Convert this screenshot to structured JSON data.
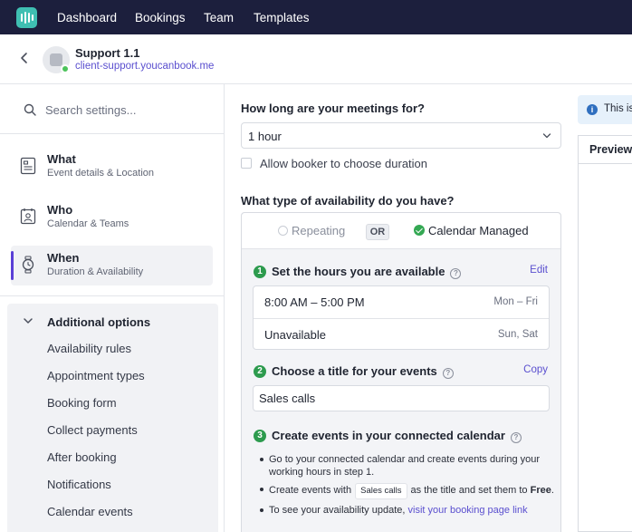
{
  "nav": {
    "items": [
      "Dashboard",
      "Bookings",
      "Team",
      "Templates"
    ]
  },
  "header": {
    "title": "Support 1.1",
    "link": "client-support.youcanbook.me"
  },
  "sidebar": {
    "search_placeholder": "Search settings...",
    "items": [
      {
        "label": "What",
        "sub": "Event details & Location",
        "icon": "document-icon"
      },
      {
        "label": "Who",
        "sub": "Calendar & Teams",
        "icon": "user-card-icon"
      },
      {
        "label": "When",
        "sub": "Duration & Availability",
        "icon": "watch-icon"
      }
    ],
    "additional_title": "Additional options",
    "additional_items": [
      "Availability rules",
      "Appointment types",
      "Booking form",
      "Collect payments",
      "After booking",
      "Notifications",
      "Calendar events"
    ]
  },
  "main": {
    "duration_question": "How long are your meetings for?",
    "duration_value": "1 hour",
    "allow_booker_label": "Allow booker to choose duration",
    "availability_question": "What type of availability do you have?",
    "option_repeating": "Repeating",
    "or_label": "OR",
    "option_managed": "Calendar Managed",
    "step1": {
      "num": "1",
      "title": "Set the hours you are available",
      "action": "Edit",
      "help": "?"
    },
    "hours": [
      {
        "time": "8:00 AM – 5:00 PM",
        "days": "Mon – Fri"
      },
      {
        "time": "Unavailable",
        "days": "Sun, Sat"
      }
    ],
    "step2": {
      "num": "2",
      "title": "Choose a title for your events",
      "action": "Copy",
      "help": "?"
    },
    "event_title_value": "Sales calls",
    "step3": {
      "num": "3",
      "title": "Create events in your connected calendar",
      "help": "?"
    },
    "bullets": {
      "b1": "Go to your connected calendar and create events during your working hours in step 1.",
      "b2_prefix": "Create events with",
      "b2_code": "Sales calls",
      "b2_suffix": "as the title and set them to",
      "b2_strong": "Free",
      "b2_end": ".",
      "b3_prefix": "To see your availability update,",
      "b3_link": "visit your booking page link"
    }
  },
  "right": {
    "info_text": "This is",
    "preview_label": "Preview"
  },
  "colors": {
    "nav_bg": "#1c1f3d",
    "accent": "#5a3fd6",
    "link": "#5a4fcf",
    "step_green": "#2d9b4e",
    "logo": "#3fbfb2"
  }
}
